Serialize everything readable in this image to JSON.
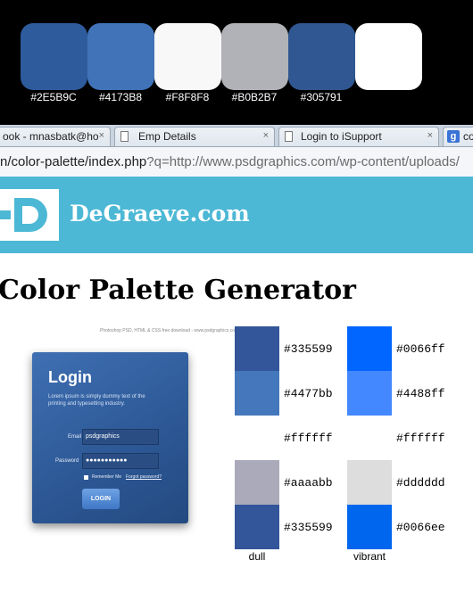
{
  "top_palette": {
    "swatches": [
      {
        "color": "#2E5B9C",
        "label": "#2E5B9C"
      },
      {
        "color": "#4173B8",
        "label": "#4173B8"
      },
      {
        "color": "#F8F8F8",
        "label": "#F8F8F8"
      },
      {
        "color": "#B0B2B7",
        "label": "#B0B2B7"
      },
      {
        "color": "#305791",
        "label": "#305791"
      },
      {
        "color": "#FFFFFF",
        "label": ""
      }
    ]
  },
  "browser": {
    "tabs": [
      {
        "title": "ook - mnasbatk@ho",
        "icon": "none"
      },
      {
        "title": "Emp Details",
        "icon": "page-icon"
      },
      {
        "title": "Login to iSupport",
        "icon": "page-icon"
      },
      {
        "title": "co",
        "icon": "google-icon"
      }
    ],
    "close_glyph": "×",
    "url_prefix": "n/color-palette/index.php",
    "url_query": "?q=http://www.psdgraphics.com/wp-content/uploads/"
  },
  "site": {
    "brand": "DeGraeve.com",
    "header_color": "#4CB8D5"
  },
  "page_title": "Color Palette Generator",
  "login_mock": {
    "caption": "Photoshop PSD, HTML & CSS free download  -  www.psdgraphics.com",
    "title": "Login",
    "subtitle": "Lorem ipsum is simply dummy text of the printing and typesetting industry.",
    "email_label": "Email",
    "email_value": "psdgraphics",
    "password_label": "Password",
    "password_value": "●●●●●●●●●●●",
    "remember_label": "Remember Me",
    "forgot_label": "Forgot password?",
    "button_label": "LOGIN"
  },
  "palettes": {
    "dull": {
      "name": "dull",
      "swatches": [
        {
          "color": "#335599",
          "hex": "#335599"
        },
        {
          "color": "#4477bb",
          "hex": "#4477bb"
        },
        {
          "color": "#ffffff",
          "hex": "#ffffff"
        },
        {
          "color": "#aaaabb",
          "hex": "#aaaabb"
        },
        {
          "color": "#335599",
          "hex": "#335599"
        }
      ]
    },
    "vibrant": {
      "name": "vibrant",
      "swatches": [
        {
          "color": "#0066ff",
          "hex": "#0066ff"
        },
        {
          "color": "#4488ff",
          "hex": "#4488ff"
        },
        {
          "color": "#ffffff",
          "hex": "#ffffff"
        },
        {
          "color": "#dddddd",
          "hex": "#dddddd"
        },
        {
          "color": "#0066ee",
          "hex": "#0066ee"
        }
      ]
    }
  }
}
